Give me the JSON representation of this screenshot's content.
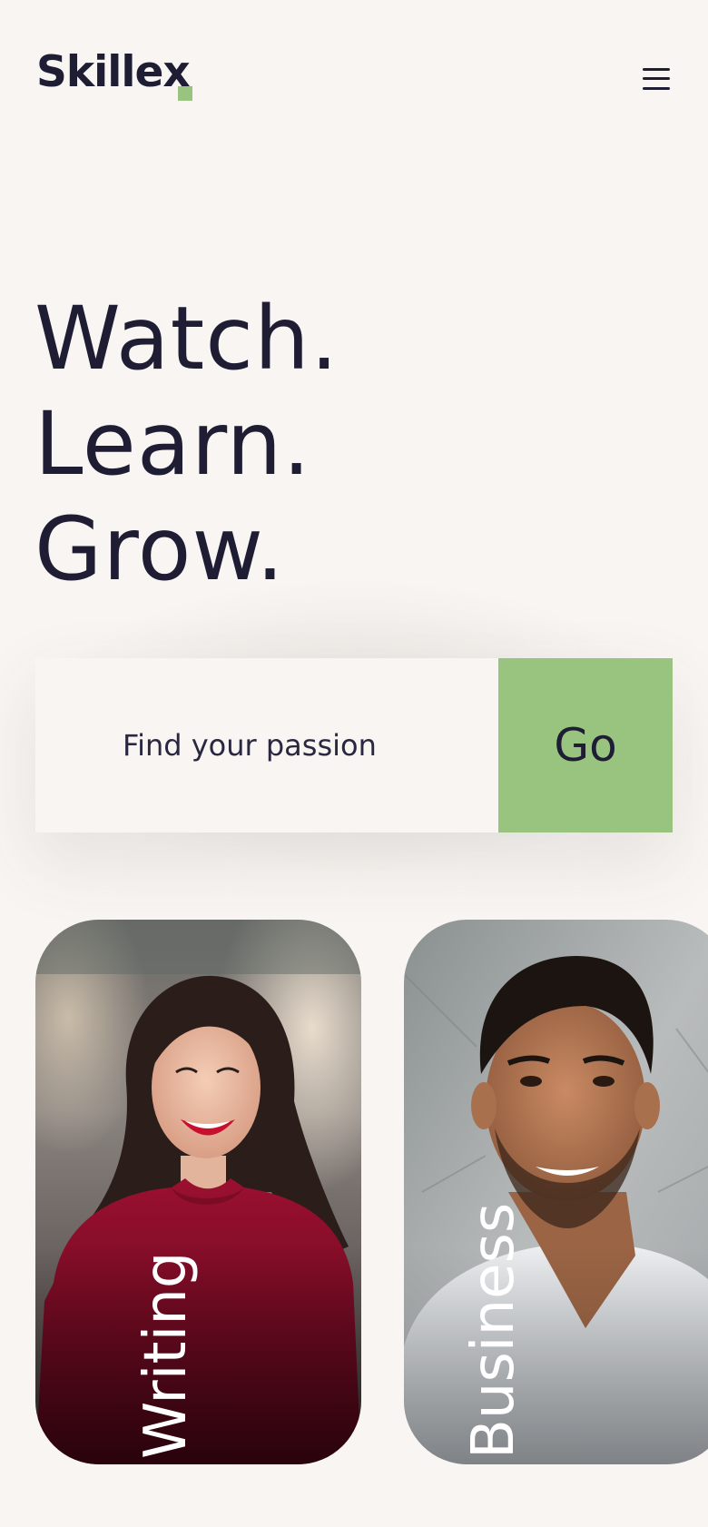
{
  "header": {
    "logo_text": "Skillex",
    "logo_dot_color": "#98c47f",
    "menu_icon": "hamburger-menu-icon"
  },
  "hero": {
    "lines": [
      "Watch.",
      "Learn.",
      "Grow."
    ]
  },
  "search": {
    "placeholder": "Find your passion",
    "value": "",
    "button_label": "Go",
    "button_color": "#98c47f"
  },
  "categories": [
    {
      "label": "Writing",
      "image": "smiling-woman-red-top-photo"
    },
    {
      "label": "Business",
      "image": "smiling-man-white-shirt-photo"
    }
  ],
  "colors": {
    "background": "#f8f5f2",
    "text": "#1f1d33",
    "accent": "#98c47f"
  }
}
